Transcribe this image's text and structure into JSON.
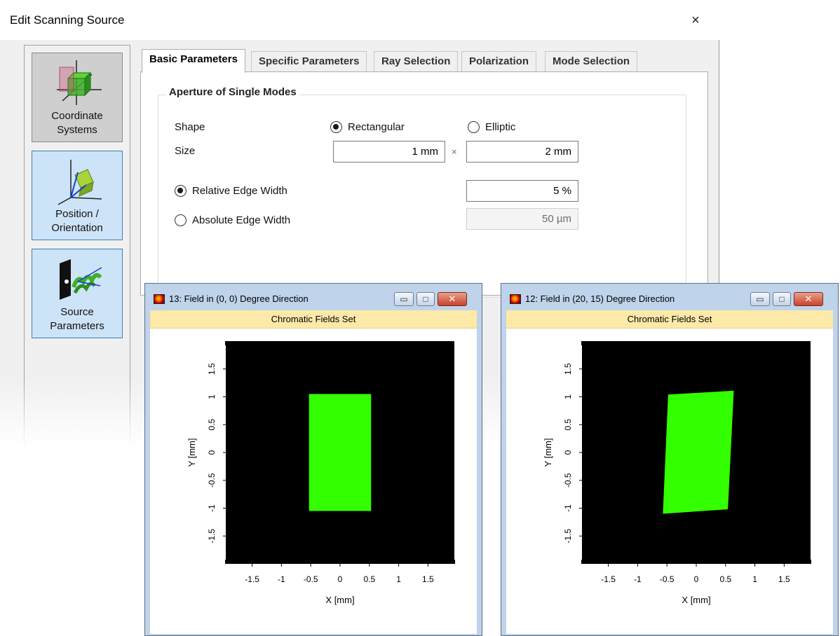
{
  "dialog": {
    "title": "Edit Scanning Source",
    "close_glyph": "×"
  },
  "nav": [
    {
      "label_line1": "Coordinate",
      "label_line2": "Systems",
      "icon": "coordinate-systems-icon"
    },
    {
      "label_line1": "Position /",
      "label_line2": "Orientation",
      "icon": "position-orientation-icon"
    },
    {
      "label_line1": "Source",
      "label_line2": "Parameters",
      "icon": "source-parameters-icon"
    }
  ],
  "tabs": [
    "Basic Parameters",
    "Specific Parameters",
    "Ray Selection",
    "Polarization",
    "Mode Selection"
  ],
  "aperture": {
    "group_title": "Aperture of Single Modes",
    "shape_label": "Shape",
    "shape_options": [
      "Rectangular",
      "Elliptic"
    ],
    "shape_selected": "Rectangular",
    "size_label": "Size",
    "size_x": "1 mm",
    "size_sep": "×",
    "size_y": "2 mm",
    "edge_options": [
      "Relative Edge Width",
      "Absolute Edge Width"
    ],
    "edge_selected": "Relative Edge Width",
    "relative_edge_value": "5 %",
    "absolute_edge_value": "50 µm"
  },
  "windows": [
    {
      "title": "13: Field in (0, 0) Degree Direction",
      "band": "Chromatic Fields Set",
      "chart_data": {
        "type": "heatmap",
        "xlabel": "X [mm]",
        "ylabel": "Y [mm]",
        "xlim": [
          -1.95,
          1.95
        ],
        "ylim": [
          -2.0,
          2.0
        ],
        "xticks": [
          "-1.5",
          "-1",
          "-0.5",
          "0",
          "0.5",
          "1",
          "1.5"
        ],
        "yticks": [
          "1.5",
          "1",
          "0.5",
          "0",
          "-0.5",
          "-1",
          "-1.5"
        ],
        "background_color": "#000000",
        "field_color": "#33ff00",
        "field_polygon": [
          [
            -0.53,
            1.05
          ],
          [
            0.53,
            1.05
          ],
          [
            0.53,
            -1.05
          ],
          [
            -0.53,
            -1.05
          ]
        ]
      }
    },
    {
      "title": "12: Field in (20, 15) Degree Direction",
      "band": "Chromatic Fields Set",
      "chart_data": {
        "type": "heatmap",
        "xlabel": "X [mm]",
        "ylabel": "Y [mm]",
        "xlim": [
          -1.95,
          1.95
        ],
        "ylim": [
          -2.0,
          2.0
        ],
        "xticks": [
          "-1.5",
          "-1",
          "-0.5",
          "0",
          "0.5",
          "1",
          "1.5"
        ],
        "yticks": [
          "1.5",
          "1",
          "0.5",
          "0",
          "-0.5",
          "-1",
          "-1.5"
        ],
        "background_color": "#000000",
        "field_color": "#33ff00",
        "field_polygon": [
          [
            -0.48,
            1.04
          ],
          [
            0.64,
            1.11
          ],
          [
            0.54,
            -1.02
          ],
          [
            -0.57,
            -1.1
          ]
        ]
      }
    }
  ],
  "window_buttons": {
    "min": "▭",
    "max": "□",
    "close": "✕"
  }
}
